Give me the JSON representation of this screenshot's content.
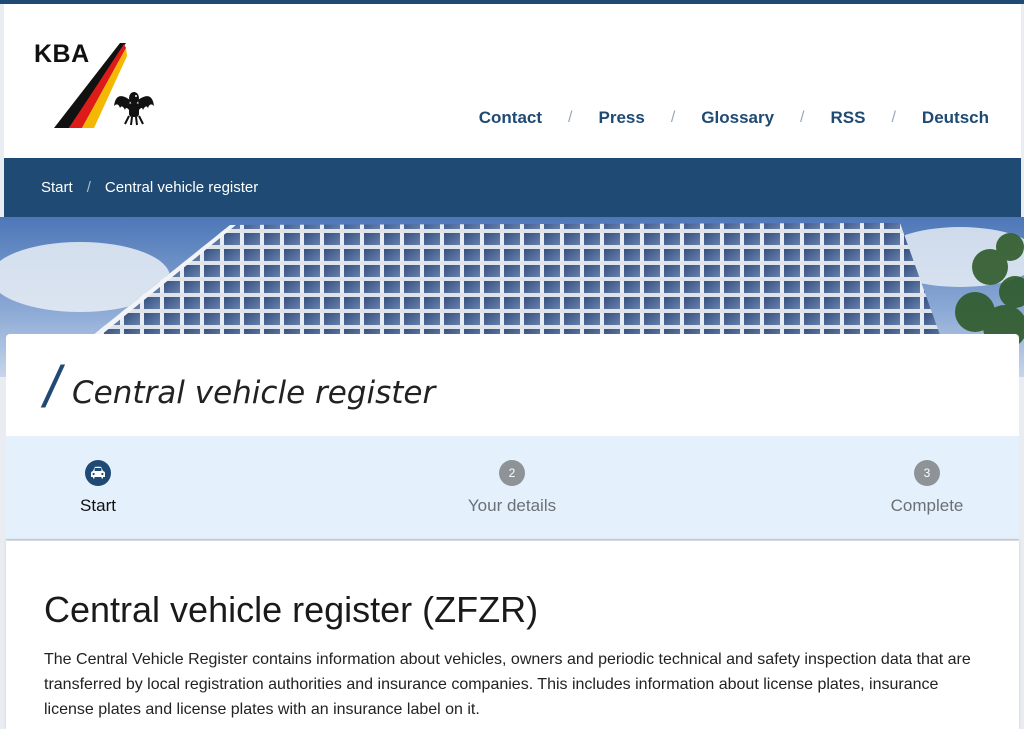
{
  "brand": {
    "logo_text": "KBA"
  },
  "nav": {
    "items": [
      {
        "label": "Contact"
      },
      {
        "label": "Press"
      },
      {
        "label": "Glossary"
      },
      {
        "label": "RSS"
      },
      {
        "label": "Deutsch"
      }
    ],
    "separator": "/"
  },
  "breadcrumb": {
    "items": [
      {
        "label": "Start"
      },
      {
        "label": "Central vehicle register"
      }
    ],
    "separator": "/"
  },
  "title": {
    "slash": "/",
    "text": "Central vehicle register"
  },
  "stepper": {
    "steps": [
      {
        "number": "",
        "icon": "car-icon",
        "label": "Start",
        "state": "active"
      },
      {
        "number": "2",
        "label": "Your details",
        "state": "inactive"
      },
      {
        "number": "3",
        "label": "Complete",
        "state": "inactive"
      }
    ]
  },
  "content": {
    "heading": "Central vehicle register (ZFZR)",
    "paragraph": "The Central Vehicle Register contains information about vehicles, owners and periodic technical and safety inspection data that are transferred by local registration authorities and insurance companies. This includes information about license plates, insurance license plates and license plates with an insurance label on it."
  },
  "colors": {
    "primary": "#1f4a73",
    "stepper_bg": "#e4f0fb",
    "inactive_step": "#8e9398",
    "flag_black": "#111111",
    "flag_red": "#dd1c1a",
    "flag_gold": "#f5b800"
  }
}
